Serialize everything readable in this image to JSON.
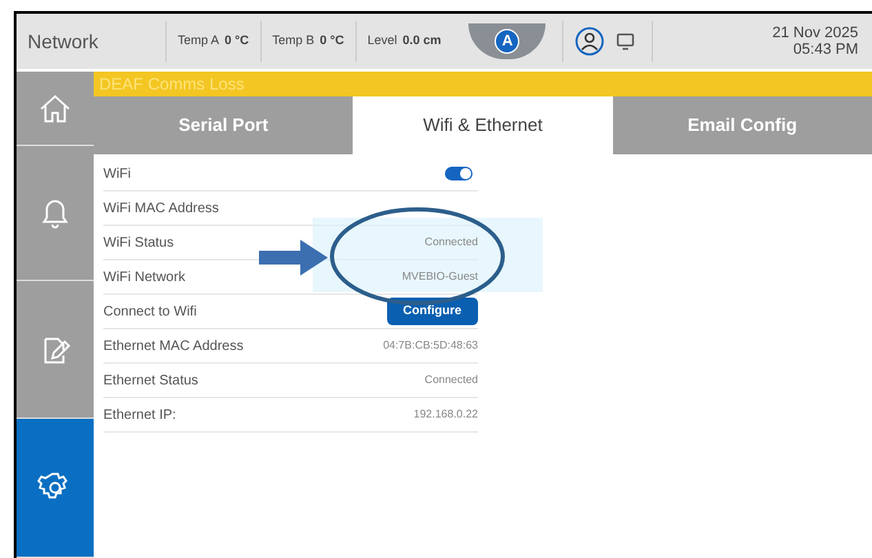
{
  "header": {
    "title": "Network",
    "readings": [
      {
        "label": "Temp A",
        "value": "0 °C"
      },
      {
        "label": "Temp B",
        "value": "0 °C"
      },
      {
        "label": "Level",
        "value": "0.0 cm"
      }
    ],
    "mode_badge": "A",
    "date": "21 Nov 2025",
    "time": "05:43 PM"
  },
  "alarm_banner": "DEAF Comms Loss",
  "sidebar": {
    "items": [
      {
        "kind": "home",
        "selected": false
      },
      {
        "kind": "bell",
        "selected": false
      },
      {
        "kind": "edit",
        "selected": false
      },
      {
        "kind": "gear",
        "selected": true
      }
    ]
  },
  "tabs": [
    {
      "label": "Serial Port",
      "selected": false
    },
    {
      "label": "Wifi & Ethernet",
      "selected": true
    },
    {
      "label": "Email Config",
      "selected": false
    }
  ],
  "rows": [
    {
      "kind": "toggle",
      "label": "WiFi",
      "on": true
    },
    {
      "kind": "text",
      "label": "WiFi MAC Address"
    },
    {
      "kind": "text",
      "label": "WiFi Status",
      "value": "Connected"
    },
    {
      "kind": "text",
      "label": "WiFi Network",
      "value": "MVEBIO-Guest"
    },
    {
      "kind": "button",
      "label": "Connect to Wifi",
      "value": "Configure"
    },
    {
      "kind": "text",
      "label": "Ethernet MAC Address",
      "value": "04:7B:CB:5D:48:63"
    },
    {
      "kind": "text",
      "label": "Ethernet Status",
      "value": "Connected"
    },
    {
      "kind": "text",
      "label": "Ethernet IP:",
      "value": "192.168.0.22"
    }
  ]
}
